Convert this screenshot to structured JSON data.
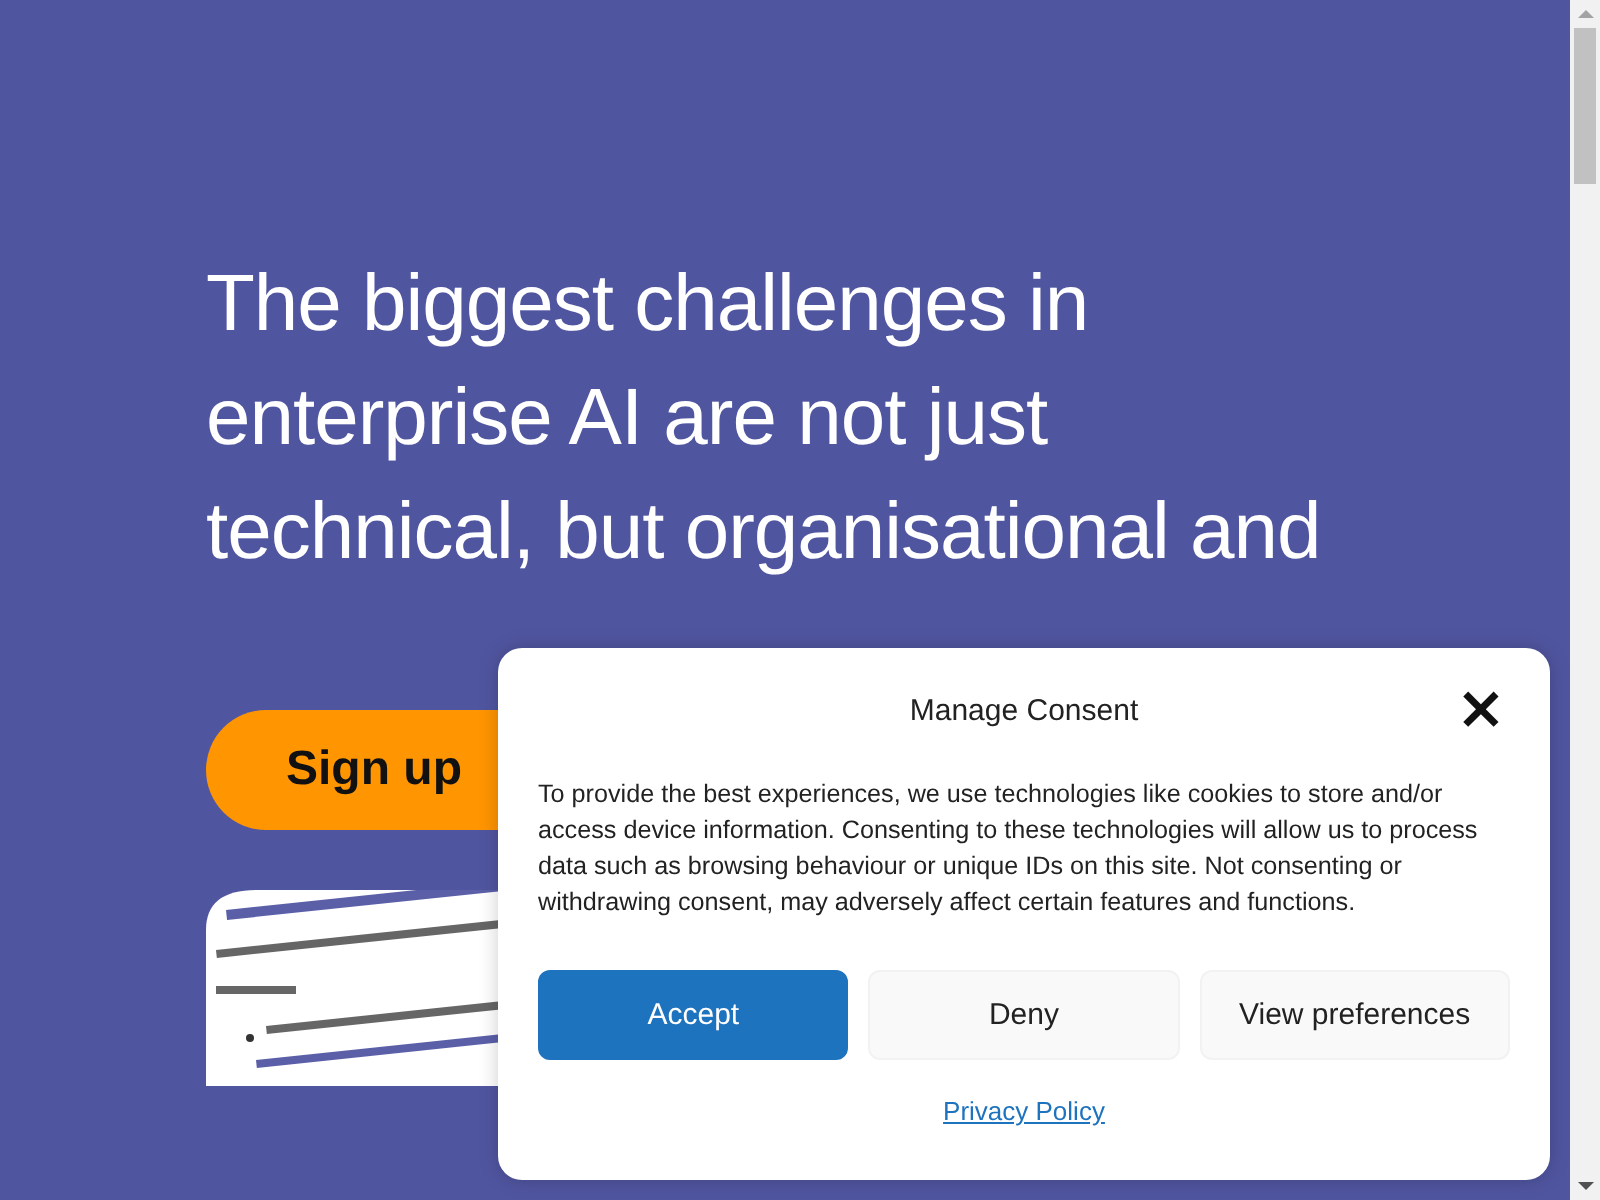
{
  "hero": {
    "heading": "The biggest challenges in enterprise AI are not just technical, but organisational and",
    "signup_button": "Sign up"
  },
  "consent": {
    "title": "Manage Consent",
    "close": "×",
    "body": "To provide the best experiences, we use technologies like cookies to store and/or access device information. Consenting to these technologies will allow us to process data such as browsing behaviour or unique IDs on this site. Not consenting or withdrawing consent, may adversely affect certain features and functions.",
    "buttons": [
      {
        "label": "Accept",
        "kind": "primary"
      },
      {
        "label": "Deny",
        "kind": "secondary"
      },
      {
        "label": "View preferences",
        "kind": "secondary"
      }
    ],
    "link": "Privacy Policy"
  }
}
